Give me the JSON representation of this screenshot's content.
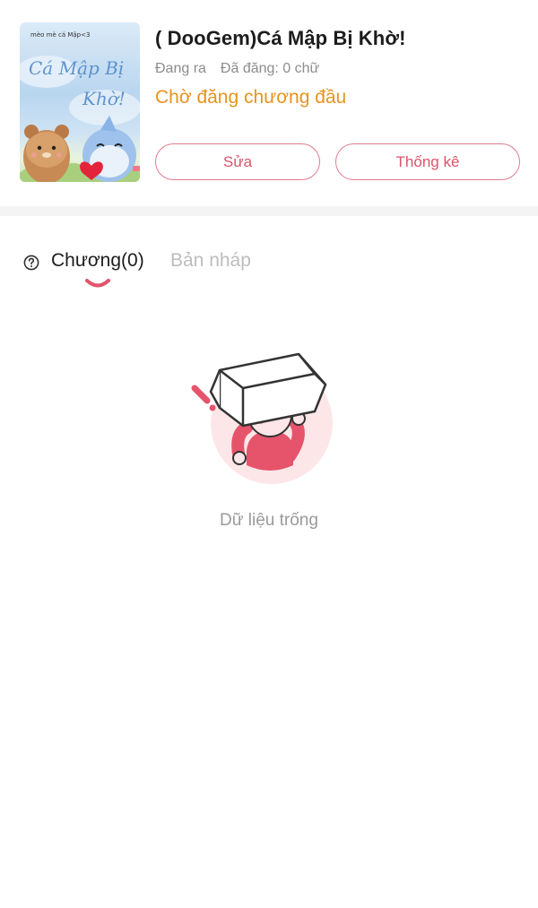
{
  "story": {
    "cover_caption": "mèo mè cá Mập<3",
    "cover_title_art": "Cá Mập Bị Khờ!",
    "title": "( DooGem)Cá Mập Bị Khờ!",
    "status_label": "Đang ra",
    "word_count": "Đã đăng: 0 chữ",
    "publish_status": "Chờ đăng chương đầu"
  },
  "actions": {
    "edit_label": "Sửa",
    "stats_label": "Thống kê"
  },
  "tabs": [
    {
      "label": "Chương(0)",
      "active": true
    },
    {
      "label": "Bản nháp",
      "active": false
    }
  ],
  "empty_state": {
    "message": "Dữ liệu trống"
  },
  "colors": {
    "accent": "#d9546a",
    "warning": "#e7931e"
  },
  "icons": {
    "help": "question-circle-icon"
  }
}
